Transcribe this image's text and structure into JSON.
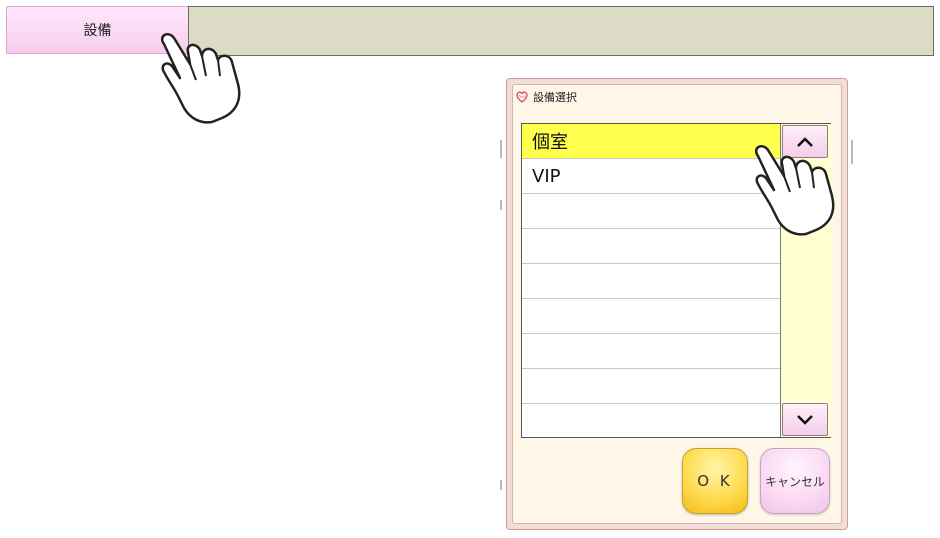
{
  "toolbar": {
    "tab_label": "設備"
  },
  "dialog": {
    "title": "設備選択",
    "title_icon": "heart-icon",
    "items": [
      {
        "label": "個室",
        "selected": true
      },
      {
        "label": "VIP",
        "selected": false
      },
      {
        "label": "",
        "selected": false
      },
      {
        "label": "",
        "selected": false
      },
      {
        "label": "",
        "selected": false
      },
      {
        "label": "",
        "selected": false
      },
      {
        "label": "",
        "selected": false
      },
      {
        "label": "",
        "selected": false
      },
      {
        "label": "",
        "selected": false
      }
    ],
    "scroll_up_icon": "chevron-up-icon",
    "scroll_down_icon": "chevron-down-icon",
    "ok_label": "O K",
    "cancel_label": "キャンセル"
  },
  "colors": {
    "tab_bg": "#f6cdee",
    "field_bg": "#dcdbc5",
    "selected_row": "#ffff4d",
    "scroll_track": "#ffffd0",
    "ok_button": "#ffd84a",
    "cancel_button": "#fad8f3"
  }
}
